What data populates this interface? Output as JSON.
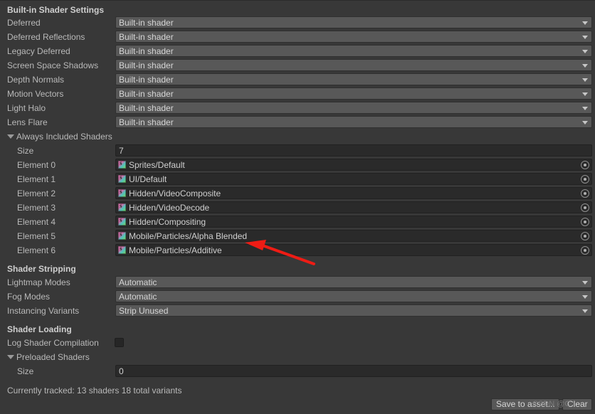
{
  "panel": {
    "builtin_section_title": "Built-in Shader Settings",
    "builtin_rows": [
      {
        "label": "Deferred",
        "value": "Built-in shader"
      },
      {
        "label": "Deferred Reflections",
        "value": "Built-in shader"
      },
      {
        "label": "Legacy Deferred",
        "value": "Built-in shader"
      },
      {
        "label": "Screen Space Shadows",
        "value": "Built-in shader"
      },
      {
        "label": "Depth Normals",
        "value": "Built-in shader"
      },
      {
        "label": "Motion Vectors",
        "value": "Built-in shader"
      },
      {
        "label": "Light Halo",
        "value": "Built-in shader"
      },
      {
        "label": "Lens Flare",
        "value": "Built-in shader"
      }
    ],
    "always_included": {
      "foldout_label": "Always Included Shaders",
      "size_label": "Size",
      "size_value": "7",
      "elements": [
        {
          "label": "Element 0",
          "value": "Sprites/Default"
        },
        {
          "label": "Element 1",
          "value": "UI/Default"
        },
        {
          "label": "Element 2",
          "value": "Hidden/VideoComposite"
        },
        {
          "label": "Element 3",
          "value": "Hidden/VideoDecode"
        },
        {
          "label": "Element 4",
          "value": "Hidden/Compositing"
        },
        {
          "label": "Element 5",
          "value": "Mobile/Particles/Alpha Blended"
        },
        {
          "label": "Element 6",
          "value": "Mobile/Particles/Additive"
        }
      ]
    },
    "shader_stripping": {
      "title": "Shader Stripping",
      "rows": [
        {
          "label": "Lightmap Modes",
          "value": "Automatic"
        },
        {
          "label": "Fog Modes",
          "value": "Automatic"
        },
        {
          "label": "Instancing Variants",
          "value": "Strip Unused"
        }
      ]
    },
    "shader_loading": {
      "title": "Shader Loading",
      "log_label": "Log Shader Compilation",
      "log_checked": false,
      "preloaded_foldout_label": "Preloaded Shaders",
      "preloaded_size_label": "Size",
      "preloaded_size_value": "0"
    },
    "status_text": "Currently tracked: 13 shaders 18 total variants",
    "footer": {
      "save_label": "Save to asset...",
      "clear_label": "Clear"
    },
    "watermark_text": "CSDN @C"
  },
  "colors": {
    "background": "#383838",
    "popup_bg": "#585858",
    "field_bg": "#2a2a2a",
    "text": "#b9b9b9",
    "annotation": "#ee1c15"
  }
}
